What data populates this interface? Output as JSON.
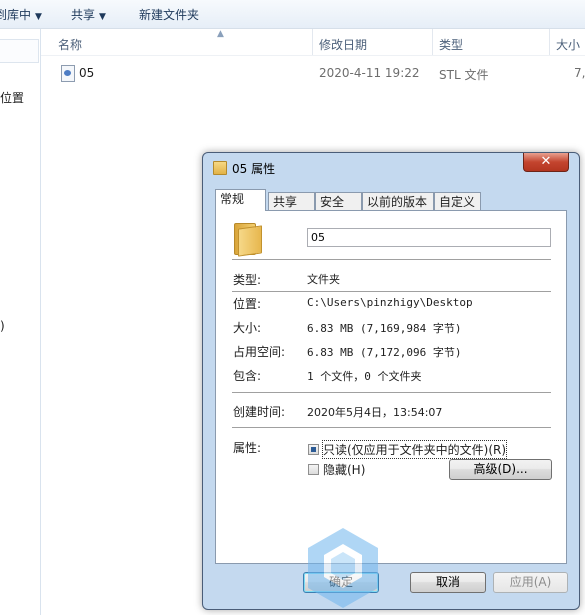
{
  "explorer": {
    "toolbar": {
      "include_library": "到库中",
      "share": "共享",
      "new_folder": "新建文件夹"
    },
    "nav": {
      "item1": "位置",
      "item2": ")"
    },
    "columns": {
      "name": "名称",
      "modified": "修改日期",
      "type": "类型",
      "size": "大小"
    },
    "file": {
      "name": "05",
      "modified": "2020-4-11 19:22",
      "type": "STL 文件",
      "size": "7,"
    }
  },
  "dialog": {
    "title": "05 属性",
    "close": "✕",
    "tabs": [
      "常规",
      "共享",
      "安全",
      "以前的版本",
      "自定义"
    ],
    "name_value": "05",
    "fields": {
      "type_label": "类型:",
      "type_value": "文件夹",
      "location_label": "位置:",
      "location_value": "C:\\Users\\pinzhigy\\Desktop",
      "size_label": "大小:",
      "size_value": "6.83 MB (7,169,984 字节)",
      "disk_label": "占用空间:",
      "disk_value": "6.83 MB (7,172,096 字节)",
      "contains_label": "包含:",
      "contains_value": "1 个文件，0 个文件夹",
      "created_label": "创建时间:",
      "created_value": "2020年5月4日，13:54:07",
      "attributes_label": "属性:"
    },
    "attributes": {
      "readonly_label": "只读(仅应用于文件夹中的文件)(R)",
      "readonly_state": "indeterminate",
      "hidden_label": "隐藏(H)",
      "hidden_checked": false,
      "advanced_label": "高级(D)..."
    },
    "buttons": {
      "ok": "确定",
      "cancel": "取消",
      "apply": "应用(A)"
    }
  },
  "icons": [
    "folder-icon",
    "stl-file-icon",
    "close-icon",
    "chevron-down-icon",
    "sort-up-icon",
    "watermark-logo"
  ]
}
